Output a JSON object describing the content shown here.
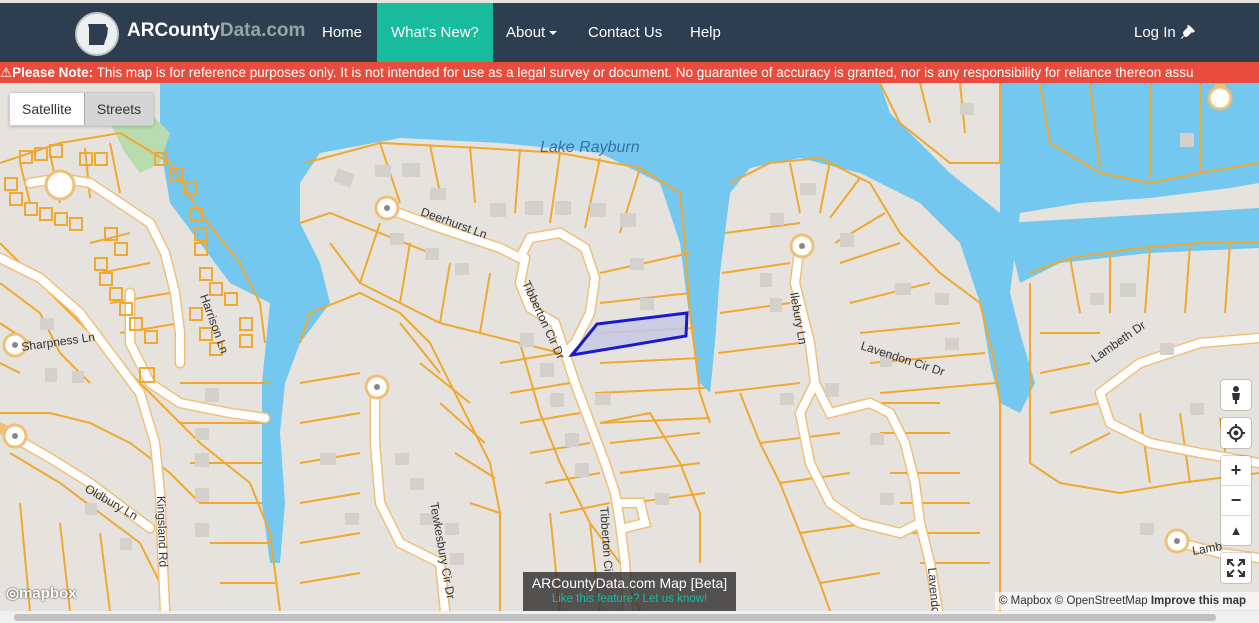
{
  "nav": {
    "brand_main": "ARCounty",
    "brand_dim": "Data.com",
    "home": "Home",
    "whats_new": "What's New?",
    "about": "About",
    "contact": "Contact Us",
    "help": "Help",
    "login": "Log In",
    "active_color": "#18bc9c",
    "bar_color": "#2c3e50"
  },
  "notice": {
    "label": "Please Note:",
    "text": " This map is for reference purposes only. It is not intended for use as a legal survey or document. No guarantee of accuracy is granted, nor is any responsibility for reliance thereon assu",
    "color": "#e74c3c"
  },
  "layers": {
    "satellite": "Satellite",
    "streets": "Streets",
    "selected": "Streets"
  },
  "map": {
    "lake_name": "Lake Rayburn",
    "streets": [
      "Deerhurst Ln",
      "Tibberton Cir Dr",
      "Harrison Ln",
      "Sharpness Ln",
      "Oldbury Ln",
      "Kingsland Rd",
      "Tewkesbury Cir Dr",
      "Tibberton Ci",
      "Ilebury Ln",
      "Lavendon Cir Dr",
      "Lambeth Dr",
      "Lamb",
      "Lavendo"
    ],
    "water_color": "#74c7ee",
    "parcel_line_color": "#f0a830",
    "selected_parcel_color": "#1a1acc"
  },
  "controls": {
    "zoom_in": "+",
    "zoom_out": "−",
    "north": "▲",
    "fullscreen": "⛶"
  },
  "mapbox_logo": "mapbox",
  "caption": {
    "title": "ARCountyData.com Map [Beta]",
    "sub": "Like this feature? Let us know!"
  },
  "attribution": {
    "text": "© Mapbox © OpenStreetMap ",
    "improve": "Improve this map"
  }
}
